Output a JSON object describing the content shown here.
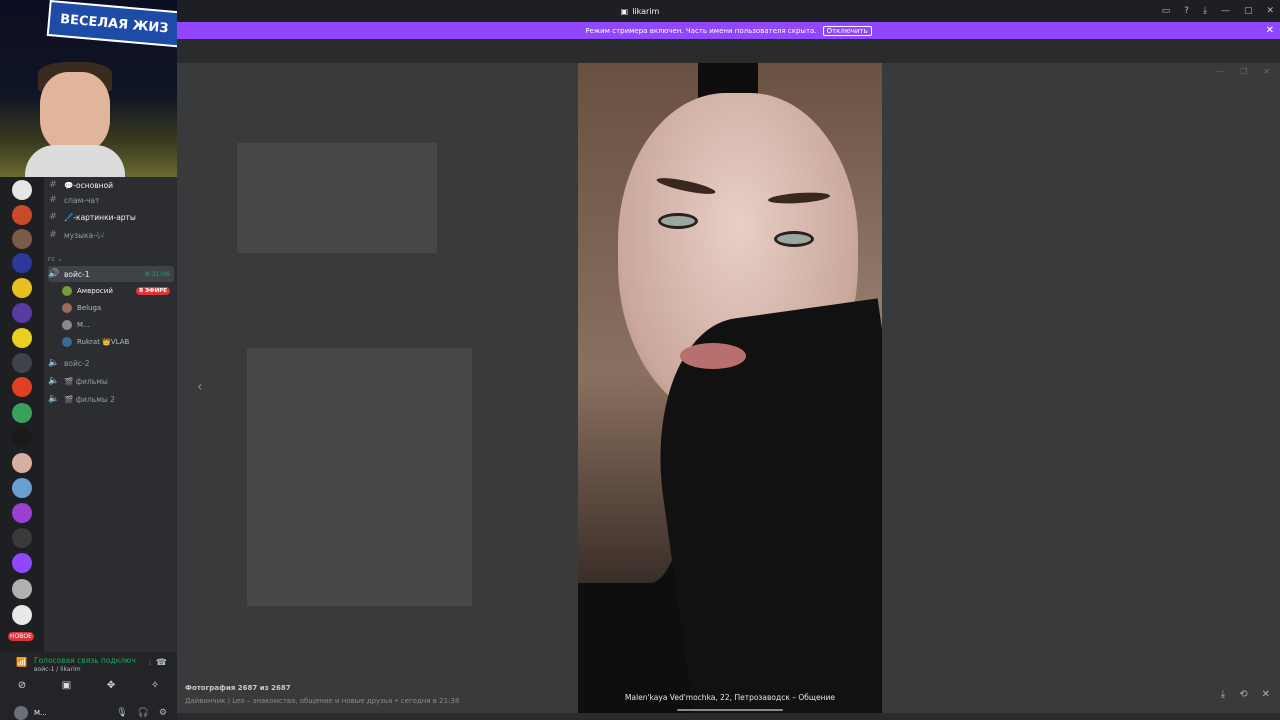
{
  "window": {
    "title": "likarim"
  },
  "banner": {
    "text": "Режим стримера включен. Часть имени пользователя скрыта.",
    "button": "Отключить"
  },
  "webcam": {
    "sign_text": "ВЕСЕЛАЯ ЖИЗ"
  },
  "sidebar": {
    "channels": [
      {
        "label": "💬-основной"
      },
      {
        "label": "спам-чат"
      },
      {
        "label": "🖊️-картинки-арты"
      },
      {
        "label": "музыка-🎶"
      }
    ],
    "category": "гс ⌄",
    "active_voice": {
      "label": "войс-1",
      "time": "8:31:06"
    },
    "members": [
      {
        "name": "Амвросий",
        "badge": "В ЭФИРЕ"
      },
      {
        "name": "Beluga"
      },
      {
        "name": "М..."
      },
      {
        "name": "Rukrat 👑VLAB"
      }
    ],
    "voice_channels": [
      {
        "label": "войс-2"
      },
      {
        "label": "🎬 фильмы"
      },
      {
        "label": "🎬 фильмы 2"
      }
    ],
    "new_badge": "НОВОЕ"
  },
  "voice_panel": {
    "status": "Голосовая связь подключ",
    "sub": "войс-1 / likarim",
    "user": "М..."
  },
  "viewer": {
    "caption": "Malen'kaya Ved'mochka, 22, Петрозаводск – Общение",
    "photo_counter": "Фотография 2687 из 2687",
    "source": "Дайвинчик | Leo – знакомства, общение и новые друзья • сегодня в 21:38"
  }
}
